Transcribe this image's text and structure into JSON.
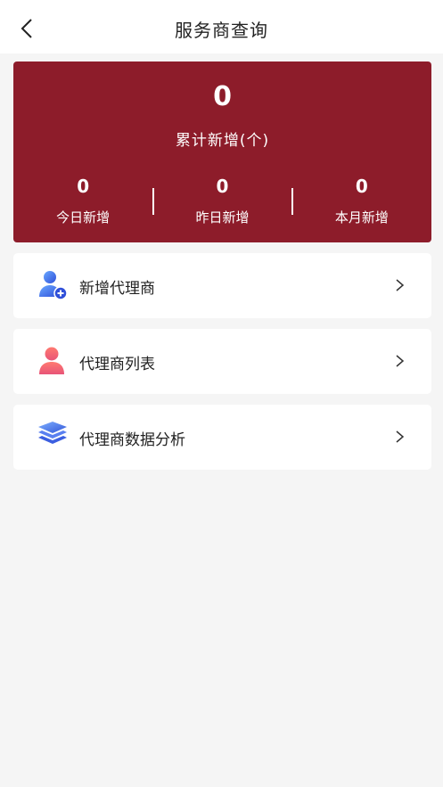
{
  "header": {
    "title": "服务商查询"
  },
  "stats": {
    "total_value": "0",
    "total_label": "累计新增(个)",
    "today": {
      "value": "0",
      "label": "今日新增"
    },
    "yesterday": {
      "value": "0",
      "label": "昨日新增"
    },
    "month": {
      "value": "0",
      "label": "本月新增"
    }
  },
  "menu": {
    "items": [
      {
        "label": "新增代理商",
        "icon": "add-user-icon"
      },
      {
        "label": "代理商列表",
        "icon": "user-icon"
      },
      {
        "label": "代理商数据分析",
        "icon": "layers-icon"
      }
    ]
  },
  "colors": {
    "card": "#8d1c2a",
    "background": "#f5f5f5"
  }
}
